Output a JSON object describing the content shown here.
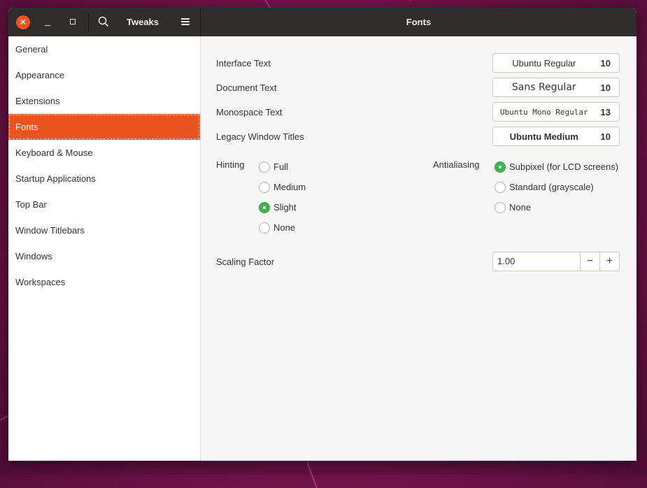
{
  "window": {
    "app_title": "Tweaks",
    "page_title": "Fonts"
  },
  "icons": {
    "close": "close-icon",
    "minimize": "minimize-icon",
    "maximize": "maximize-icon",
    "search": "search-icon",
    "menu": "hamburger-menu-icon"
  },
  "sidebar": {
    "items": [
      {
        "label": "General"
      },
      {
        "label": "Appearance"
      },
      {
        "label": "Extensions"
      },
      {
        "label": "Fonts",
        "active": true
      },
      {
        "label": "Keyboard & Mouse"
      },
      {
        "label": "Startup Applications"
      },
      {
        "label": "Top Bar"
      },
      {
        "label": "Window Titlebars"
      },
      {
        "label": "Windows"
      },
      {
        "label": "Workspaces"
      }
    ]
  },
  "fonts": {
    "interface": {
      "label": "Interface Text",
      "font": "Ubuntu Regular",
      "size": "10"
    },
    "document": {
      "label": "Document Text",
      "font": "Sans Regular",
      "size": "10"
    },
    "monospace": {
      "label": "Monospace Text",
      "font": "Ubuntu Mono Regular",
      "size": "13"
    },
    "legacy": {
      "label": "Legacy Window Titles",
      "font": "Ubuntu Medium",
      "size": "10"
    }
  },
  "hinting": {
    "label": "Hinting",
    "options": [
      "Full",
      "Medium",
      "Slight",
      "None"
    ],
    "selected": "Slight"
  },
  "antialiasing": {
    "label": "Antialiasing",
    "options": [
      "Subpixel (for LCD screens)",
      "Standard (grayscale)",
      "None"
    ],
    "selected": "Subpixel (for LCD screens)"
  },
  "scaling": {
    "label": "Scaling Factor",
    "value": "1.00",
    "decrement": "−",
    "increment": "+"
  },
  "colors": {
    "accent": "#e95420",
    "radio_checked": "#3eb34f",
    "headerbar": "#2f2c2b"
  }
}
